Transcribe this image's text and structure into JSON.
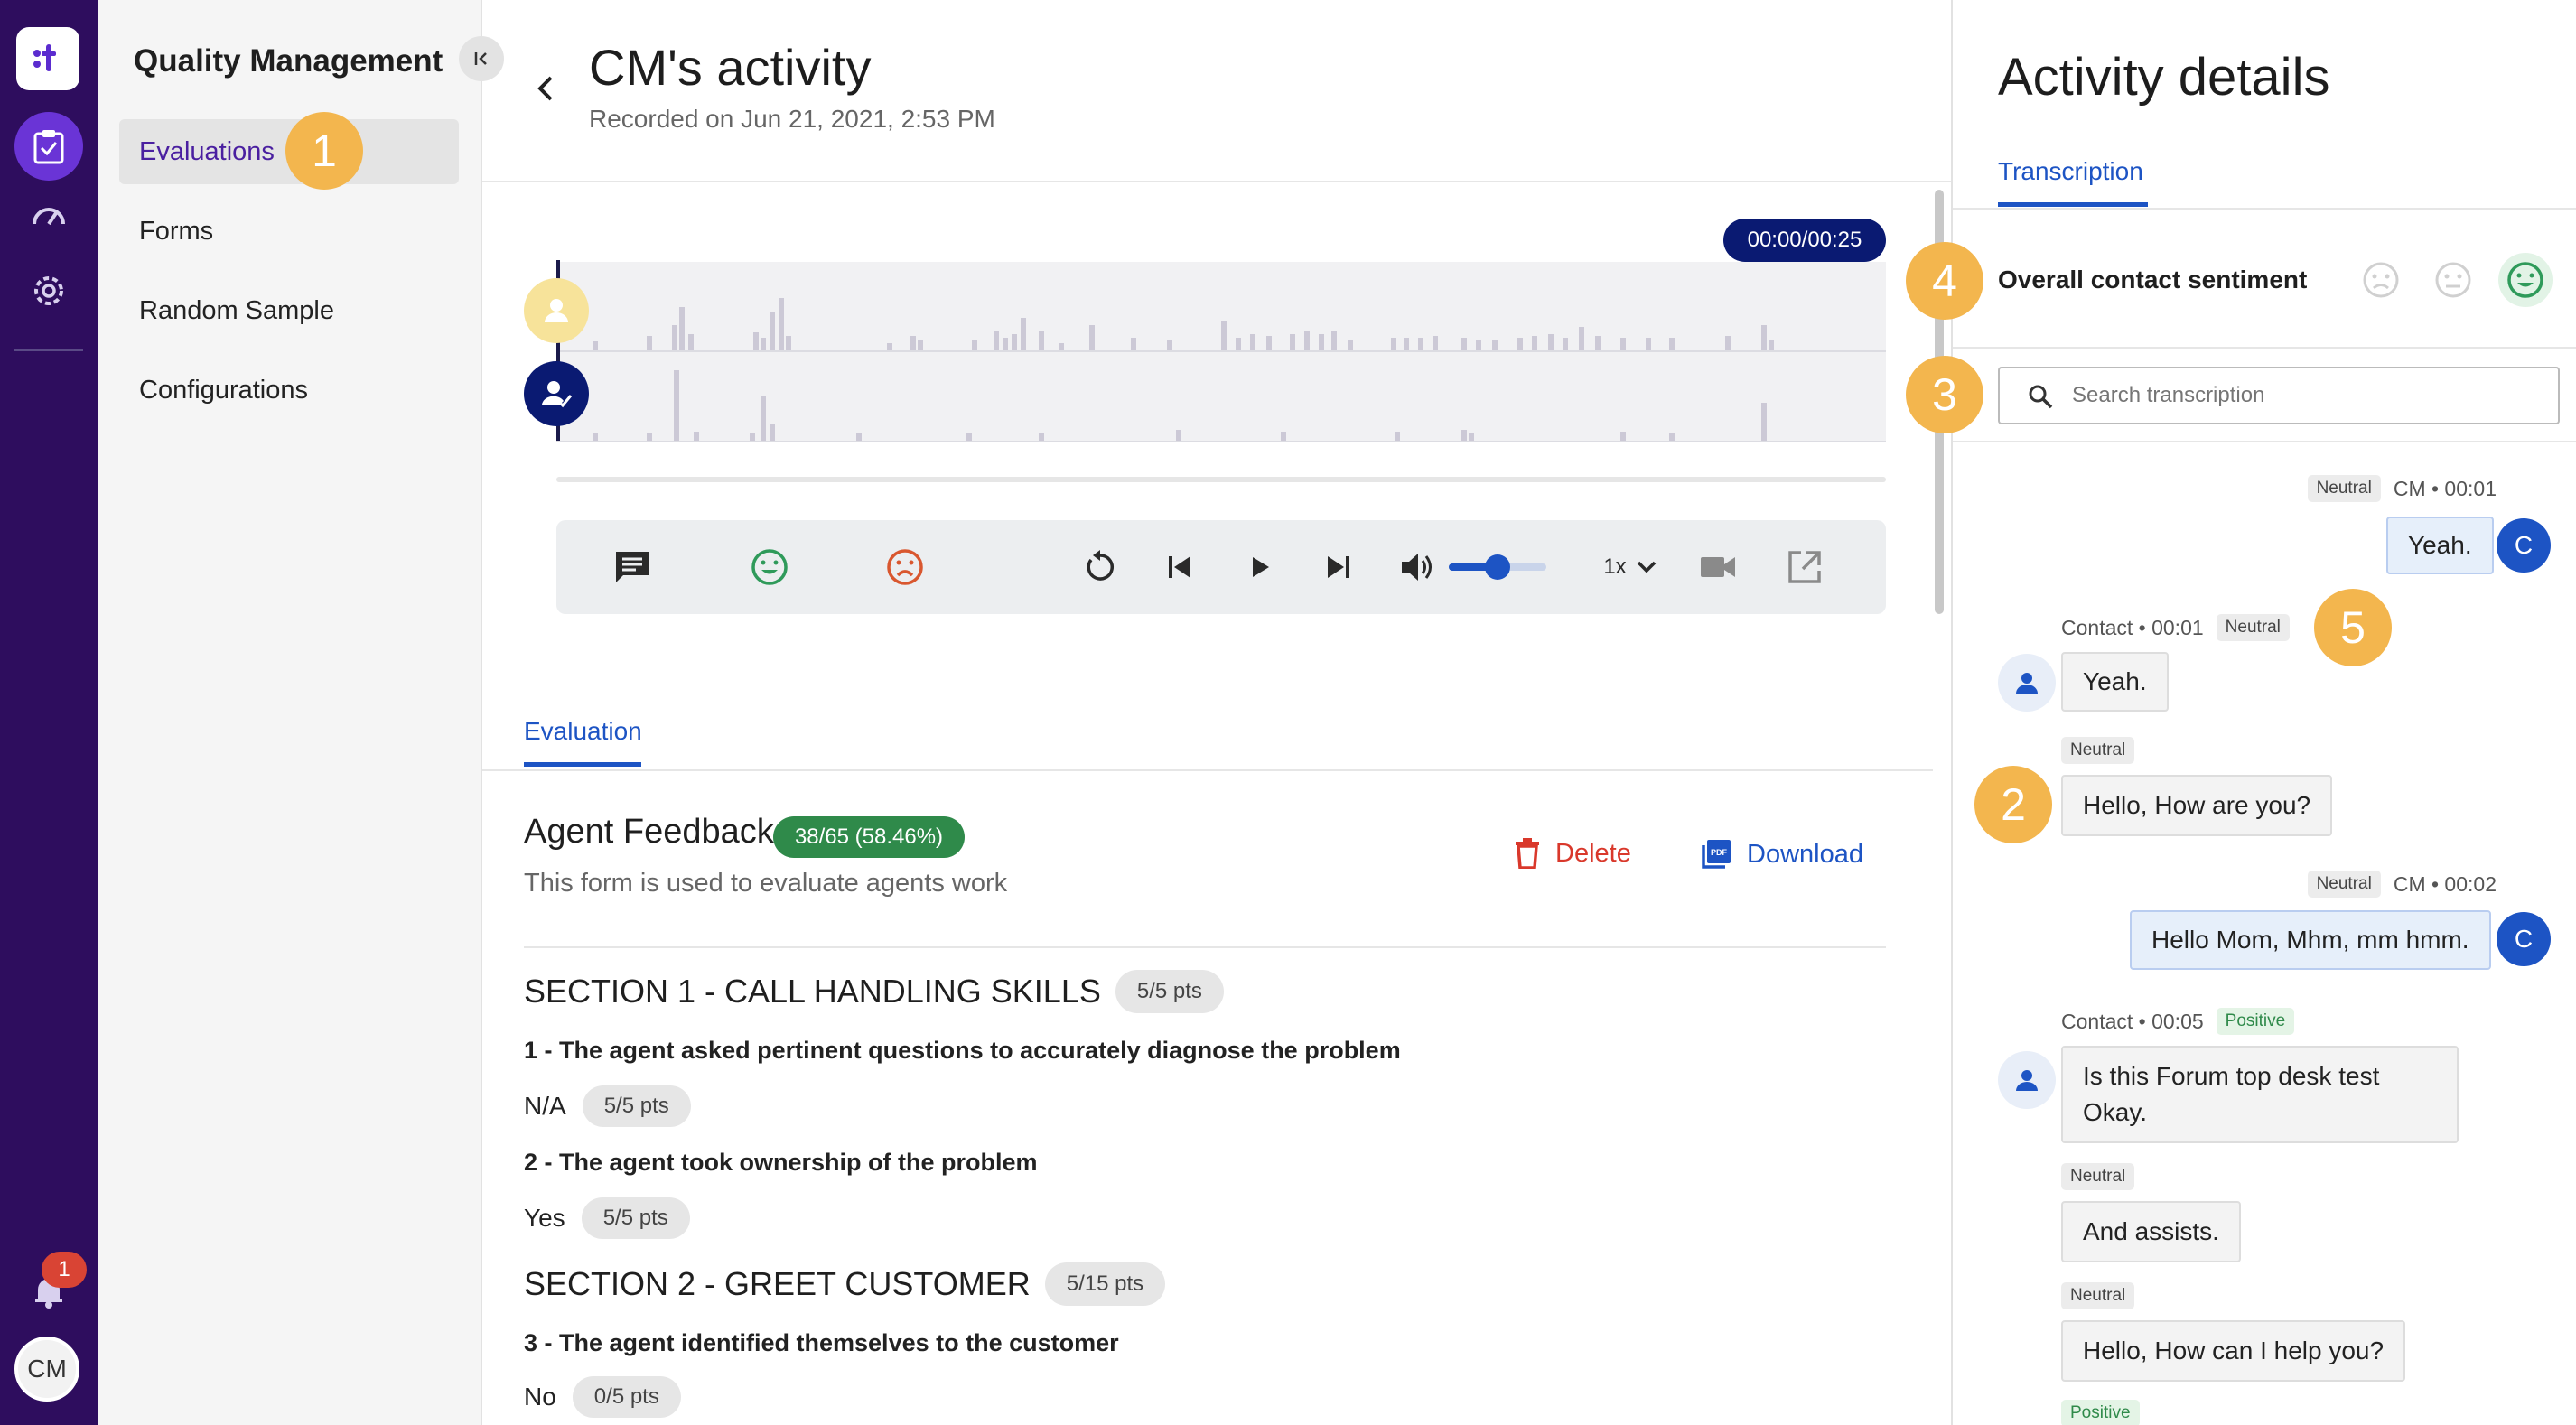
{
  "rail": {
    "logo_text": "t",
    "notifications_count": "1",
    "user_initials": "CM"
  },
  "sidebar": {
    "title": "Quality Management",
    "items": [
      {
        "label": "Evaluations",
        "active": true
      },
      {
        "label": "Forms"
      },
      {
        "label": "Random Sample"
      },
      {
        "label": "Configurations"
      }
    ]
  },
  "callouts": [
    "1",
    "2",
    "3",
    "4",
    "5"
  ],
  "header": {
    "title": "CM's activity",
    "subtitle": "Recorded on Jun 21, 2021, 2:53 PM"
  },
  "player": {
    "time": "00:00/00:25",
    "speed": "1x",
    "volume_level": 0.5
  },
  "evaluation": {
    "tab": "Evaluation",
    "form_title": "Agent Feedback",
    "score": "38/65 (58.46%)",
    "form_desc": "This form is used to evaluate agents work",
    "delete_label": "Delete",
    "download_label": "Download",
    "sections": [
      {
        "title": "SECTION 1 - CALL HANDLING SKILLS",
        "pts": "5/5 pts"
      },
      {
        "title": "SECTION 2 - GREET CUSTOMER",
        "pts": "5/15 pts"
      }
    ],
    "questions": [
      {
        "text": "1 - The agent asked pertinent questions to accurately diagnose the problem",
        "answer": "N/A",
        "pts": "5/5 pts"
      },
      {
        "text": "2 - The agent took ownership of the problem",
        "answer": "Yes",
        "pts": "5/5 pts"
      },
      {
        "text": "3 - The agent identified themselves to the customer",
        "answer": "No",
        "pts": "0/5 pts"
      }
    ]
  },
  "details": {
    "title": "Activity details",
    "tab": "Transcription",
    "sentiment_label": "Overall contact sentiment",
    "search_placeholder": "Search transcription",
    "messages": [
      {
        "sentiment": "Neutral",
        "meta": "CM • 00:01",
        "text": "Yeah.",
        "avatar": "C"
      },
      {
        "meta": "Contact • 00:01",
        "sentiment": "Neutral",
        "text": "Yeah."
      },
      {
        "sentiment": "Neutral",
        "text": "Hello, How are you?"
      },
      {
        "sentiment": "Neutral",
        "meta": "CM • 00:02",
        "text": "Hello Mom, Mhm, mm hmm.",
        "avatar": "C"
      },
      {
        "meta": "Contact • 00:05",
        "sentiment": "Positive",
        "text_line1": "Is this Forum top desk test",
        "text_line2": "Okay."
      },
      {
        "sentiment": "Neutral",
        "text": "And assists."
      },
      {
        "sentiment": "Neutral",
        "text": "Hello, How can I help you?"
      },
      {
        "sentiment": "Positive"
      }
    ]
  },
  "colors": {
    "rail": "#2e0d5e",
    "accent": "#1d54c4",
    "callout": "#f3b64e",
    "score_green": "#2f8a4a",
    "delete_red": "#d9382b"
  }
}
